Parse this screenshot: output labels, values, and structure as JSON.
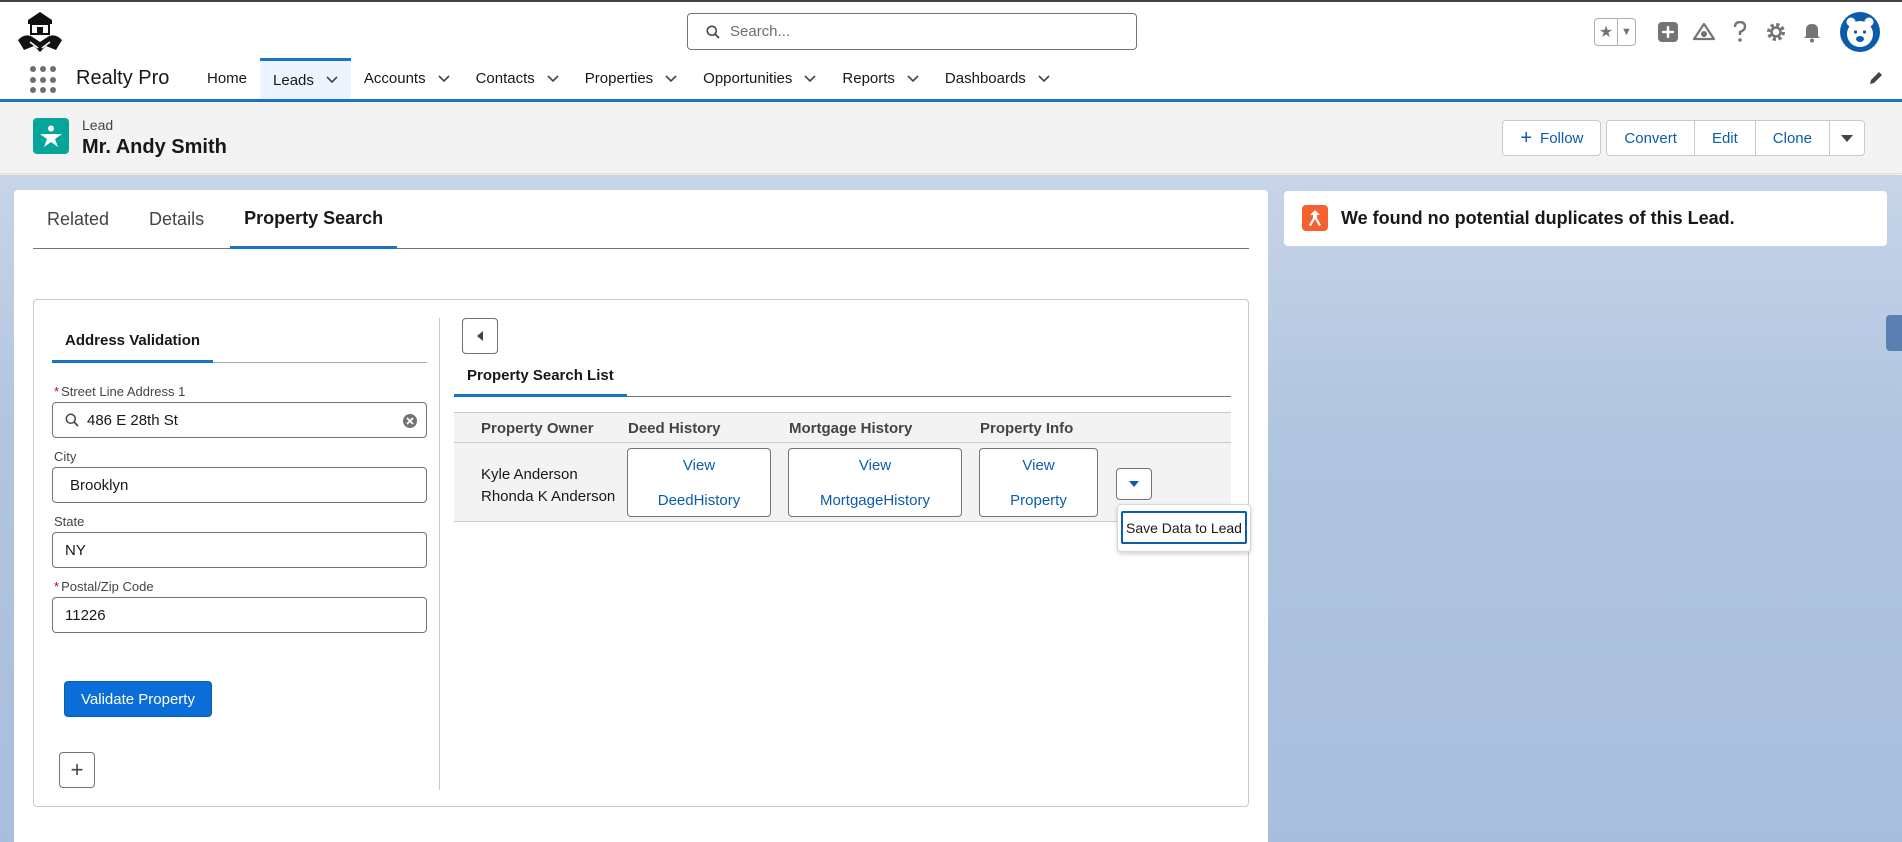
{
  "header": {
    "search_placeholder": "Search...",
    "icons": [
      "favorites-star-icon",
      "add-icon",
      "trailhead-icon",
      "help-icon",
      "setup-gear-icon",
      "bell-icon",
      "avatar"
    ]
  },
  "nav": {
    "app_name": "Realty Pro",
    "items": [
      {
        "label": "Home",
        "has_menu": false,
        "active": false
      },
      {
        "label": "Leads",
        "has_menu": true,
        "active": true
      },
      {
        "label": "Accounts",
        "has_menu": true,
        "active": false
      },
      {
        "label": "Contacts",
        "has_menu": true,
        "active": false
      },
      {
        "label": "Properties",
        "has_menu": true,
        "active": false
      },
      {
        "label": "Opportunities",
        "has_menu": true,
        "active": false
      },
      {
        "label": "Reports",
        "has_menu": true,
        "active": false
      },
      {
        "label": "Dashboards",
        "has_menu": true,
        "active": false
      }
    ]
  },
  "record": {
    "type": "Lead",
    "name": "Mr. Andy Smith",
    "actions": {
      "follow": "Follow",
      "convert": "Convert",
      "edit": "Edit",
      "clone": "Clone"
    }
  },
  "tabs": [
    {
      "label": "Related",
      "active": false
    },
    {
      "label": "Details",
      "active": false
    },
    {
      "label": "Property Search",
      "active": true
    }
  ],
  "address_validation": {
    "tab_label": "Address Validation",
    "street": {
      "label": "Street Line Address 1",
      "required": true,
      "value": "486 E 28th St"
    },
    "city": {
      "label": "City",
      "required": false,
      "value": "Brooklyn"
    },
    "state": {
      "label": "State",
      "required": false,
      "value": "NY"
    },
    "postal": {
      "label": "Postal/Zip Code",
      "required": true,
      "value": "11226"
    },
    "validate_button": "Validate Property",
    "add_button": "+"
  },
  "property_search": {
    "tab_label": "Property Search List",
    "columns": [
      "Property Owner",
      "Deed History",
      "Mortgage History",
      "Property Info"
    ],
    "rows": [
      {
        "owners": [
          "Kyle Anderson",
          "Rhonda K Anderson"
        ],
        "deed": [
          "View",
          "DeedHistory"
        ],
        "mortgage": [
          "View",
          "MortgageHistory"
        ],
        "property": [
          "View",
          "Property"
        ]
      }
    ],
    "row_menu": {
      "item": "Save Data to Lead"
    }
  },
  "duplicates": {
    "message": "We found no potential duplicates of this Lead."
  },
  "colors": {
    "brand_blue": "#0b5cab",
    "lead_icon": "#06a59a",
    "duplicate_icon": "#f4602f"
  }
}
